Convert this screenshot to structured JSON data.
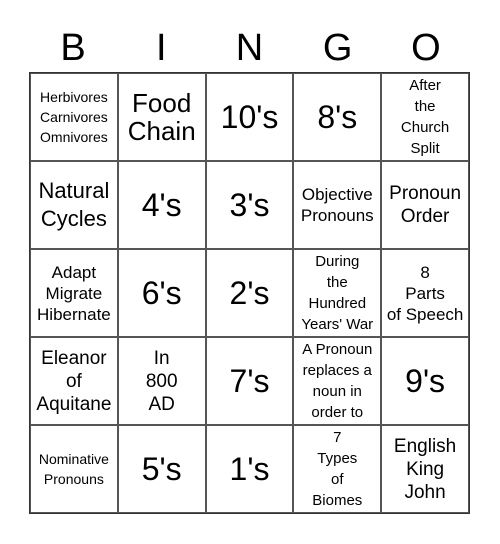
{
  "header": {
    "letters": [
      "B",
      "I",
      "N",
      "G",
      "O"
    ]
  },
  "grid": {
    "rows": [
      [
        {
          "text": "Herbivores\nCarnivores\nOmnivores",
          "size": "xs"
        },
        {
          "text": "Food\nChain",
          "size": "big"
        },
        {
          "text": "10's",
          "size": "huge"
        },
        {
          "text": "8's",
          "size": "huge"
        },
        {
          "text": "After\nthe\nChurch\nSplit",
          "size": "sm"
        }
      ],
      [
        {
          "text": "Natural\nCycles",
          "size": "lg"
        },
        {
          "text": "4's",
          "size": "huge"
        },
        {
          "text": "3's",
          "size": "huge"
        },
        {
          "text": "Objective\nPronouns",
          "size": "md"
        },
        {
          "text": "Pronoun\nOrder",
          "size": "md2"
        }
      ],
      [
        {
          "text": "Adapt\nMigrate\nHibernate",
          "size": "md"
        },
        {
          "text": "6's",
          "size": "huge"
        },
        {
          "text": "2's",
          "size": "huge"
        },
        {
          "text": "During\nthe\nHundred\nYears' War",
          "size": "sm"
        },
        {
          "text": "8\nParts\nof Speech",
          "size": "md"
        }
      ],
      [
        {
          "text": "Eleanor\nof\nAquitane",
          "size": "md2"
        },
        {
          "text": "In\n800\nAD",
          "size": "md2"
        },
        {
          "text": "7's",
          "size": "huge"
        },
        {
          "text": "A Pronoun\nreplaces a\nnoun in\norder to",
          "size": "sm"
        },
        {
          "text": "9's",
          "size": "huge"
        }
      ],
      [
        {
          "text": "Nominative\nPronouns",
          "size": "xs"
        },
        {
          "text": "5's",
          "size": "huge"
        },
        {
          "text": "1's",
          "size": "huge"
        },
        {
          "text": "7\nTypes\nof\nBiomes",
          "size": "sm"
        },
        {
          "text": "English\nKing\nJohn",
          "size": "md2"
        }
      ]
    ]
  }
}
